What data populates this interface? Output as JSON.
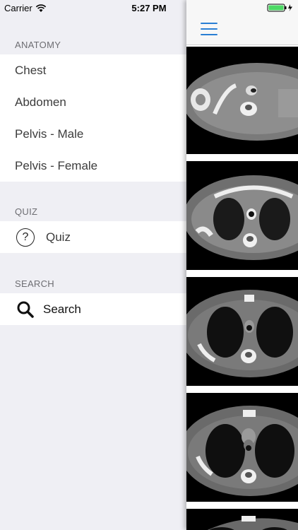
{
  "status_bar": {
    "carrier": "Carrier",
    "time": "5:27 PM",
    "battery_color": "#4cd964"
  },
  "menu": {
    "sections": [
      {
        "header": "ANATOMY",
        "items": [
          "Chest",
          "Abdomen",
          "Pelvis - Male",
          "Pelvis - Female"
        ]
      },
      {
        "header": "QUIZ",
        "items": [
          "Quiz"
        ],
        "icon": "question-circle-icon"
      },
      {
        "header": "SEARCH",
        "items": [
          "Search"
        ],
        "icon": "search-icon"
      }
    ]
  },
  "main": {
    "menu_icon": "hamburger-icon",
    "accent_color": "#2a7fd4",
    "images": [
      {
        "name": "ct-slice-1"
      },
      {
        "name": "ct-slice-2"
      },
      {
        "name": "ct-slice-3"
      },
      {
        "name": "ct-slice-4"
      },
      {
        "name": "ct-slice-5"
      }
    ]
  }
}
